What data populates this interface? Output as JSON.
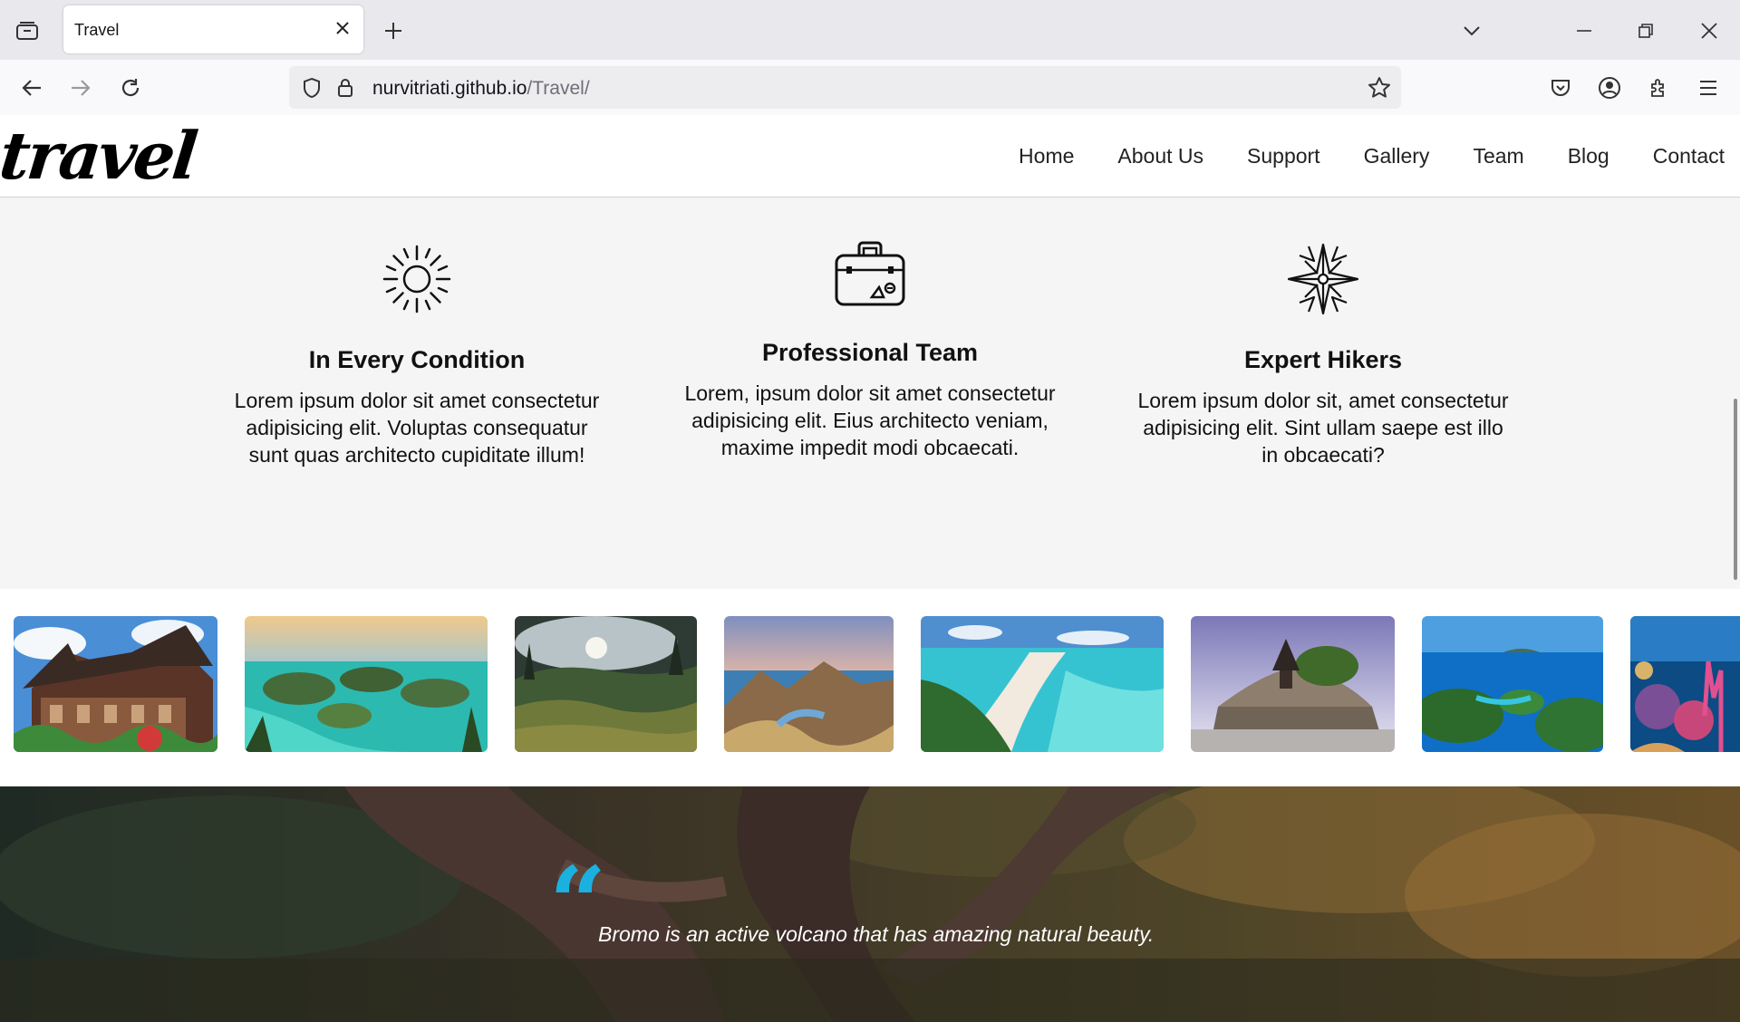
{
  "browser": {
    "tab_title": "Travel",
    "url_host": "nurvitriati.github.io",
    "url_path": "/Travel/"
  },
  "site": {
    "logo": "travel",
    "nav": [
      "Home",
      "About Us",
      "Support",
      "Gallery",
      "Team",
      "Blog",
      "Contact"
    ]
  },
  "features": [
    {
      "icon": "sun-icon",
      "title": "In Every Condition",
      "text": "Lorem ipsum dolor sit amet consectetur adipisicing elit. Voluptas consequatur sunt quas architecto cupiditate illum!"
    },
    {
      "icon": "suitcase-icon",
      "title": "Professional Team",
      "text": "Lorem, ipsum dolor sit amet consectetur adipisicing elit. Eius architecto veniam, maxime impedit modi obcaecati."
    },
    {
      "icon": "compass-rose-icon",
      "title": "Expert Hikers",
      "text": "Lorem ipsum dolor sit, amet consectetur adipisicing elit. Sint ullam saepe est illo in obcaecati?"
    }
  ],
  "gallery": {
    "photos": [
      "traditional-house",
      "island-lagoon",
      "rice-terraces-forest",
      "padar-island-hills",
      "white-sand-beach",
      "sea-temple",
      "blue-islands",
      "coral-reef"
    ]
  },
  "quote": {
    "mark": "“",
    "text": "Bromo is an active volcano that has amazing natural beauty."
  },
  "colors": {
    "quote_accent": "#1ab1e0",
    "features_bg": "#f4f5f4"
  }
}
